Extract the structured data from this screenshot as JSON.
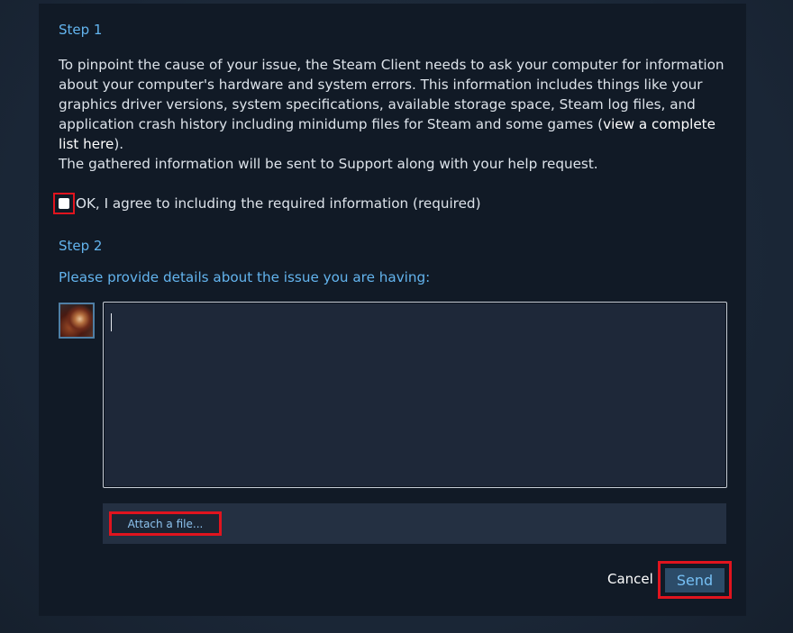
{
  "step1": {
    "heading": "Step 1",
    "paragraph_before_link": "To pinpoint the cause of your issue, the Steam Client needs to ask your computer for information about your computer's hardware and system errors. This information includes things like your graphics driver versions, system specifications, available storage space, Steam log files, and application crash history including minidump files for Steam and some games (",
    "link_label": "view a complete list here",
    "paragraph_after_link": ").",
    "gathered_info_text": "The gathered information will be sent to Support along with your help request.",
    "agree_checkbox": {
      "label": "OK, I agree to including the required information (required)",
      "checked": false
    }
  },
  "step2": {
    "heading": "Step 2",
    "prompt": "Please provide details about the issue you are having:",
    "details_input": {
      "value": ""
    },
    "attach_button_label": "Attach a file..."
  },
  "actions": {
    "cancel_label": "Cancel",
    "send_label": "Send"
  },
  "colors": {
    "accent_blue": "#63b4ee",
    "highlight_red": "#e0141e",
    "panel_bg": "#111a26",
    "send_bg": "#2c4c69"
  }
}
